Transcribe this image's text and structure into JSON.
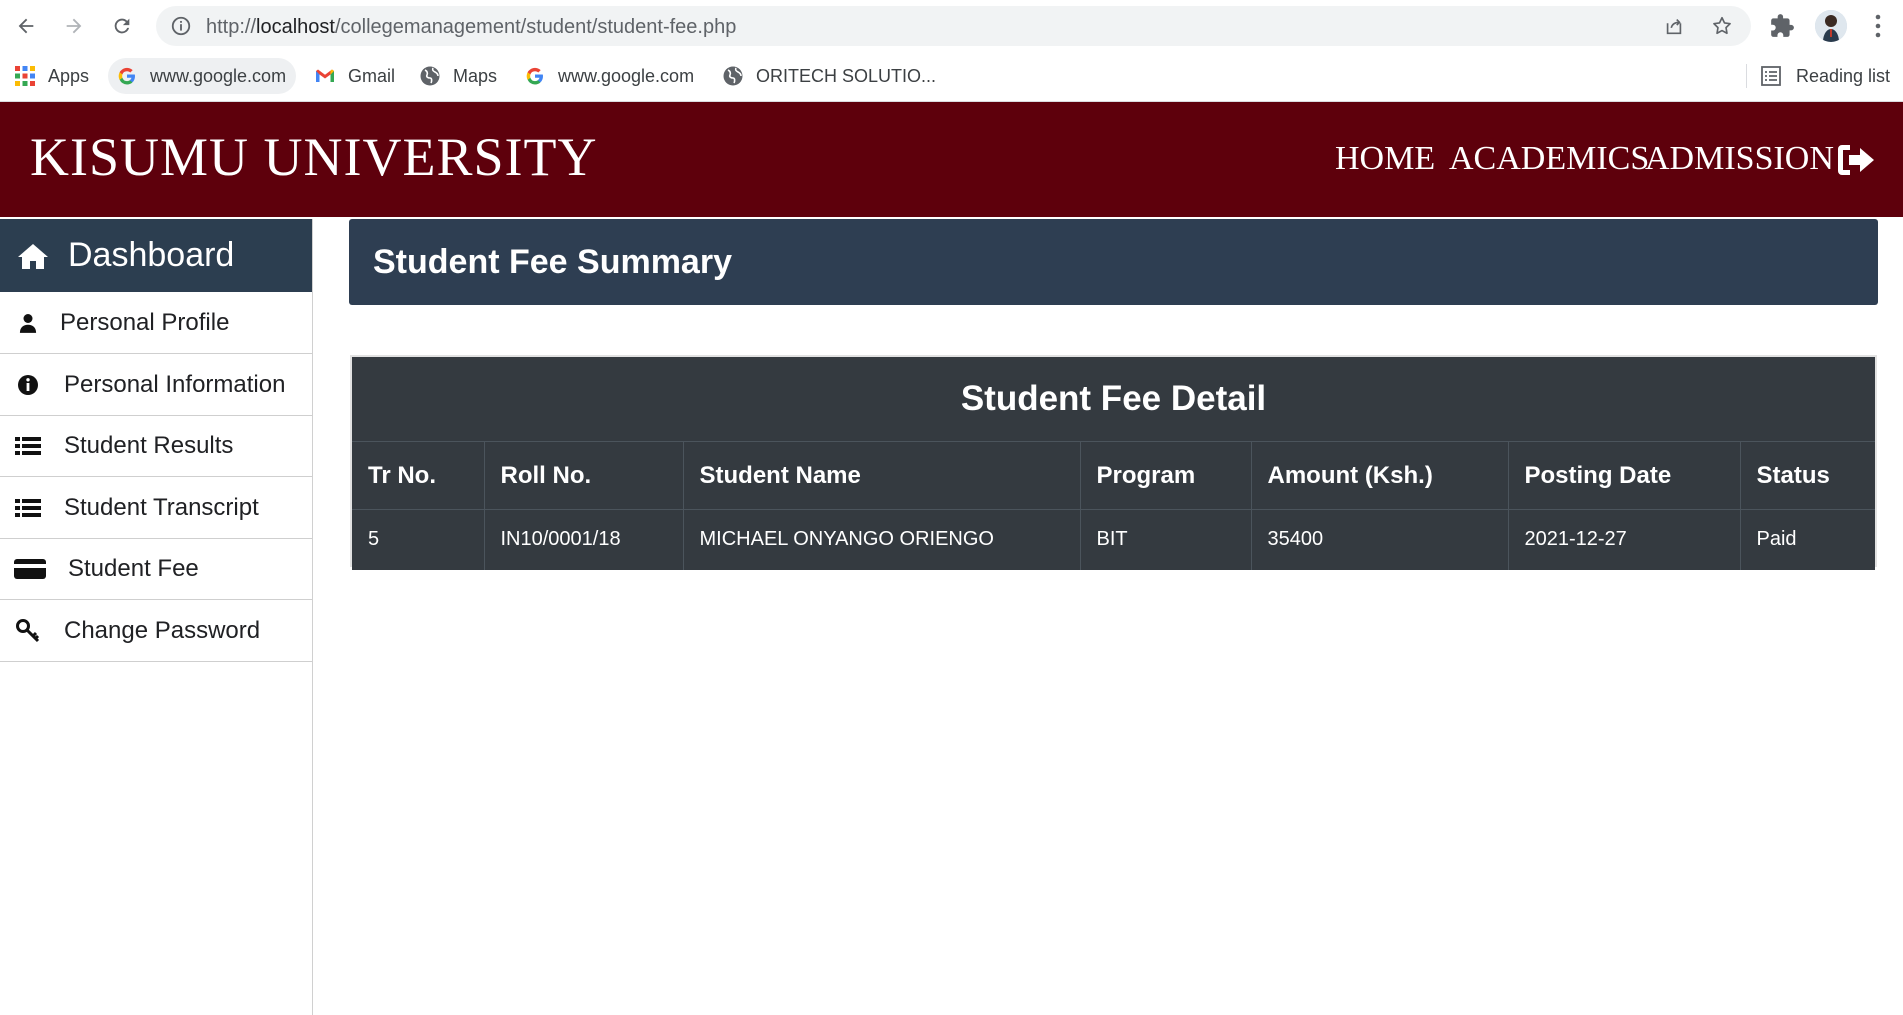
{
  "browser": {
    "url_prefix": "http://",
    "url_host": "localhost",
    "url_path": "/collegemanagement/student/student-fee.php",
    "bookmarks": [
      {
        "label": "Apps",
        "icon": "apps-grid-icon"
      },
      {
        "label": "www.google.com",
        "icon": "google-icon"
      },
      {
        "label": "Gmail",
        "icon": "gmail-icon"
      },
      {
        "label": "Maps",
        "icon": "globe-icon"
      },
      {
        "label": "www.google.com",
        "icon": "google-icon"
      },
      {
        "label": "ORITECH SOLUTIO...",
        "icon": "globe-icon"
      }
    ],
    "reading_list": "Reading list"
  },
  "header": {
    "brand": "KISUMU UNIVERSITY",
    "nav": [
      "HOME",
      "ACADEMICS",
      "ADMISSION"
    ]
  },
  "sidebar": {
    "title": "Dashboard",
    "items": [
      {
        "label": "Personal Profile",
        "icon": "user-icon"
      },
      {
        "label": "Personal Information",
        "icon": "info-icon"
      },
      {
        "label": "Student Results",
        "icon": "list-icon"
      },
      {
        "label": "Student Transcript",
        "icon": "list-icon"
      },
      {
        "label": "Student Fee",
        "icon": "credit-card-icon"
      },
      {
        "label": "Change Password",
        "icon": "key-icon"
      }
    ]
  },
  "main": {
    "summary_title": "Student Fee Summary",
    "table_title": "Student Fee Detail",
    "columns": [
      "Tr No.",
      "Roll No.",
      "Student Name",
      "Program",
      "Amount (Ksh.)",
      "Posting Date",
      "Status"
    ],
    "rows": [
      [
        "5",
        "IN10/0001/18",
        "MICHAEL ONYANGO ORIENGO",
        "BIT",
        "35400",
        "2021-12-27",
        "Paid"
      ]
    ]
  },
  "colors": {
    "header_bg": "#5e000c",
    "sidebar_head_bg": "#2c3e50",
    "summary_bg": "#2e3e52",
    "table_bg": "#343a40"
  }
}
